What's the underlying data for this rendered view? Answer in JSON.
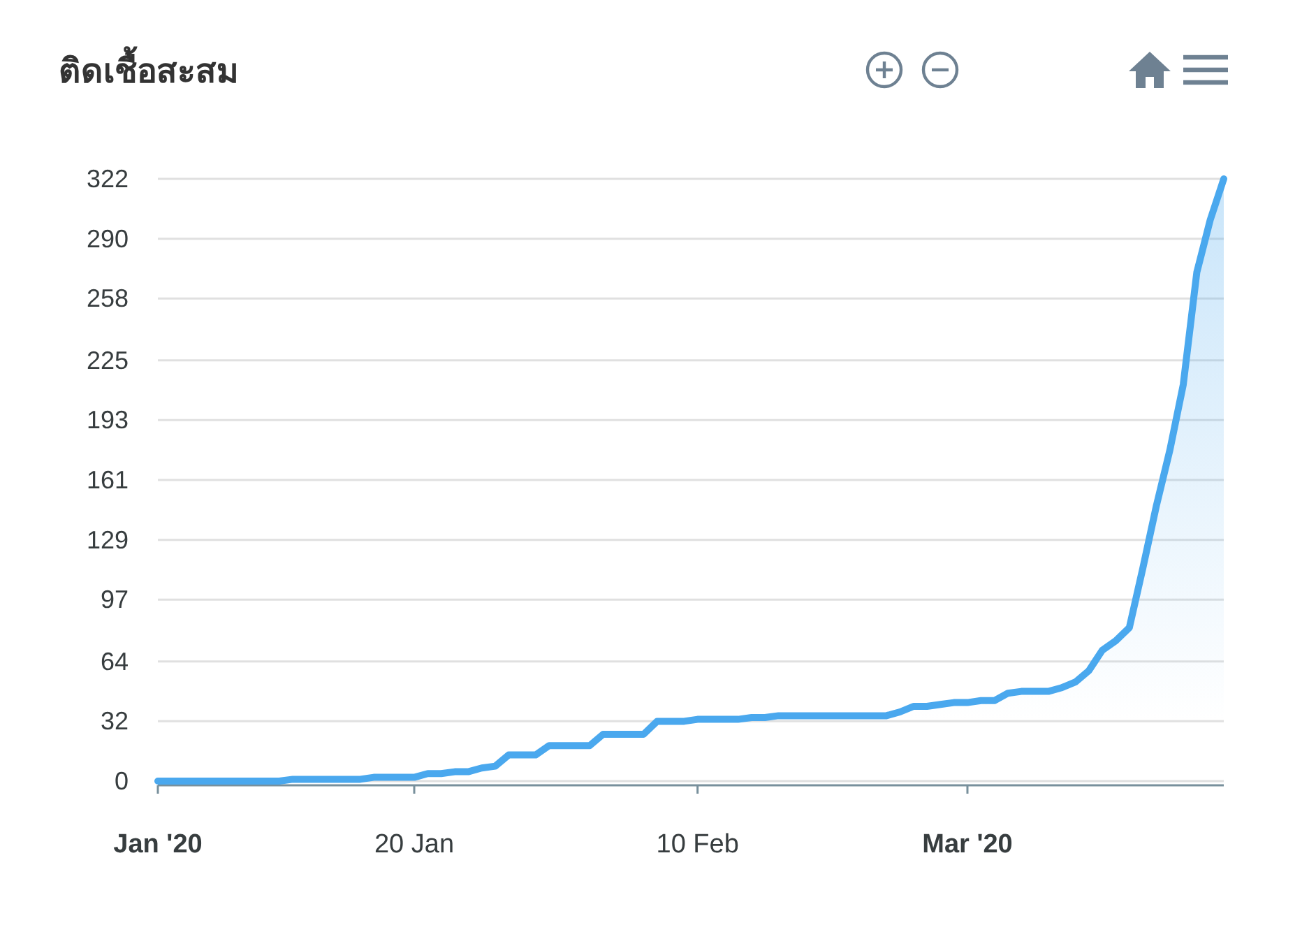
{
  "title": "ติดเชื้อสะสม",
  "chart_data": {
    "type": "area",
    "grid": true,
    "categories": [
      "**Jan '20**",
      null,
      null,
      null,
      null,
      null,
      null,
      null,
      null,
      null,
      null,
      null,
      null,
      null,
      null,
      null,
      null,
      null,
      null,
      "20 Jan",
      null,
      null,
      null,
      null,
      null,
      null,
      null,
      null,
      null,
      null,
      null,
      null,
      null,
      null,
      null,
      null,
      null,
      null,
      null,
      null,
      "10 Feb",
      null,
      null,
      null,
      null,
      null,
      null,
      null,
      null,
      null,
      null,
      null,
      null,
      null,
      null,
      null,
      null,
      null,
      null,
      null,
      "**Mar '20**",
      null,
      null,
      null,
      null,
      null,
      null,
      null,
      null,
      null,
      null,
      null,
      null,
      null,
      null,
      null,
      null,
      null,
      null,
      null
    ],
    "series": [
      {
        "color": "#4aa8ee",
        "values": [
          0,
          0,
          0,
          0,
          0,
          0,
          0,
          0,
          0,
          0,
          1,
          1,
          1,
          1,
          1,
          1,
          2,
          2,
          2,
          2,
          4,
          4,
          5,
          5,
          7,
          8,
          14,
          14,
          14,
          19,
          19,
          19,
          19,
          25,
          25,
          25,
          25,
          32,
          32,
          32,
          33,
          33,
          33,
          33,
          34,
          34,
          35,
          35,
          35,
          35,
          35,
          35,
          35,
          35,
          35,
          37,
          40,
          40,
          41,
          42,
          42,
          43,
          43,
          47,
          48,
          48,
          48,
          50,
          53,
          59,
          70,
          75,
          82,
          114,
          147,
          177,
          212,
          272,
          300,
          322
        ]
      }
    ],
    "ylim": [
      0,
      322
    ],
    "yticks": [
      {
        "value": 0,
        "label": "0"
      },
      {
        "value": 32,
        "label": "32"
      },
      {
        "value": 64,
        "label": "64"
      },
      {
        "value": 97,
        "label": "97"
      },
      {
        "value": 129,
        "label": "129"
      },
      {
        "value": 161,
        "label": "161"
      },
      {
        "value": 193,
        "label": "193"
      },
      {
        "value": 225,
        "label": "225"
      },
      {
        "value": 258,
        "label": "258"
      },
      {
        "value": 290,
        "label": "290"
      },
      {
        "value": 322,
        "label": "322"
      }
    ]
  }
}
